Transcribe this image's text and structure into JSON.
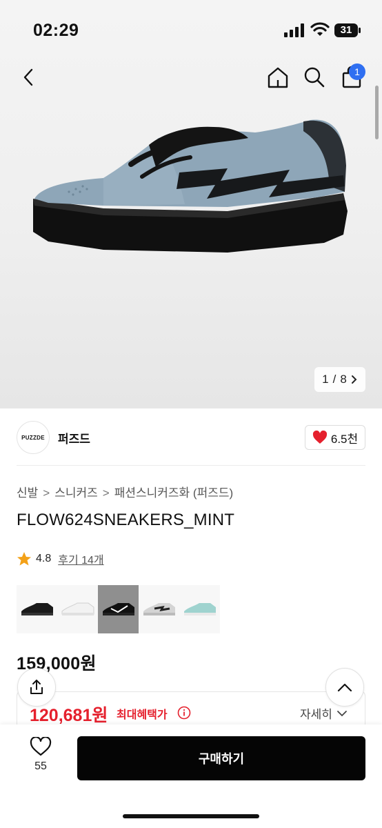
{
  "status": {
    "time": "02:29",
    "battery": "31"
  },
  "nav": {
    "cart_count": "1"
  },
  "gallery": {
    "current": "1",
    "total": "8",
    "separator": "/"
  },
  "brand": {
    "logo_text": "PUZZDE",
    "name": "퍼즈드",
    "likes": "6.5천"
  },
  "breadcrumb": [
    "신발",
    "스니커즈",
    "패션스니커즈화 (퍼즈드)"
  ],
  "product": {
    "title": "FLOW624SNEAKERS_MINT",
    "rating": "4.8",
    "reviews_label": "후기 14개",
    "price": "159,000원"
  },
  "variants": [
    {
      "name": "black",
      "selected": false
    },
    {
      "name": "white",
      "selected": false
    },
    {
      "name": "black-white",
      "selected": true
    },
    {
      "name": "grey",
      "selected": false
    },
    {
      "name": "mint",
      "selected": false
    }
  ],
  "benefit": {
    "price": "120,681원",
    "label": "최대혜택가",
    "detail_label": "자세히"
  },
  "bottom": {
    "wish_count": "55",
    "buy_label": "구매하기"
  },
  "colors": {
    "accent_red": "#e5202d",
    "badge_blue": "#2f6ff1",
    "buy_bg": "#050505"
  }
}
